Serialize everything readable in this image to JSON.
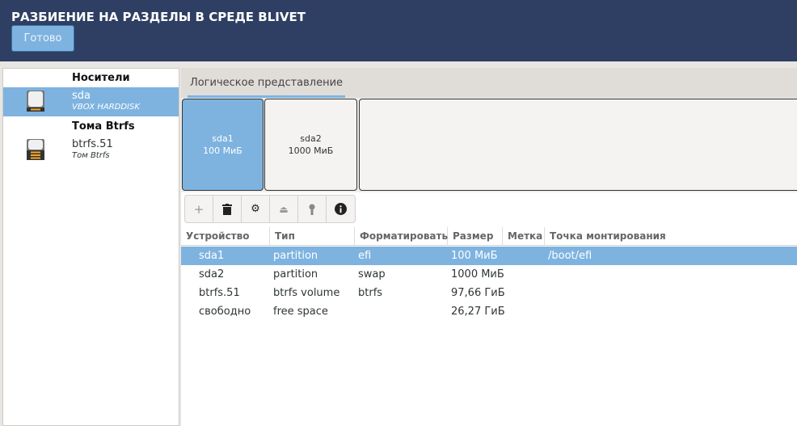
{
  "header": {
    "title": "РАЗБИЕНИЕ НА РАЗДЕЛЫ В СРЕДЕ BLIVET",
    "done_label": "Готово"
  },
  "sidebar": {
    "groups": [
      {
        "label": "Носители"
      },
      {
        "label": "Тома Btrfs"
      }
    ],
    "devices": [
      {
        "name": "sda",
        "subtitle": "VBOX HARDDISK"
      },
      {
        "name": "btrfs.51",
        "subtitle": "Том Btrfs"
      }
    ]
  },
  "tabs": [
    {
      "label": "Логическое представление"
    }
  ],
  "partitions": [
    {
      "name": "sda1",
      "size": "100 МиБ"
    },
    {
      "name": "sda2",
      "size": "1000 МиБ"
    }
  ],
  "toolbar": {
    "icons": [
      "add-icon",
      "delete-icon",
      "settings-icon",
      "unmount-icon",
      "decrypt-icon",
      "info-icon"
    ]
  },
  "table": {
    "columns": [
      "Устройство",
      "Тип",
      "Форматировать",
      "Размер",
      "Метка",
      "Точка монтирования"
    ],
    "rows": [
      [
        "sda1",
        "partition",
        "efi",
        "100 МиБ",
        "",
        "/boot/efi"
      ],
      [
        "sda2",
        "partition",
        "swap",
        "1000 МиБ",
        "",
        ""
      ],
      [
        "btrfs.51",
        "btrfs volume",
        "btrfs",
        "97,66 ГиБ",
        "",
        ""
      ],
      [
        "свободно",
        "free space",
        "",
        "26,27 ГиБ",
        "",
        ""
      ]
    ]
  },
  "colors": {
    "header": "#2e3f63",
    "accent": "#7eb3e0"
  }
}
